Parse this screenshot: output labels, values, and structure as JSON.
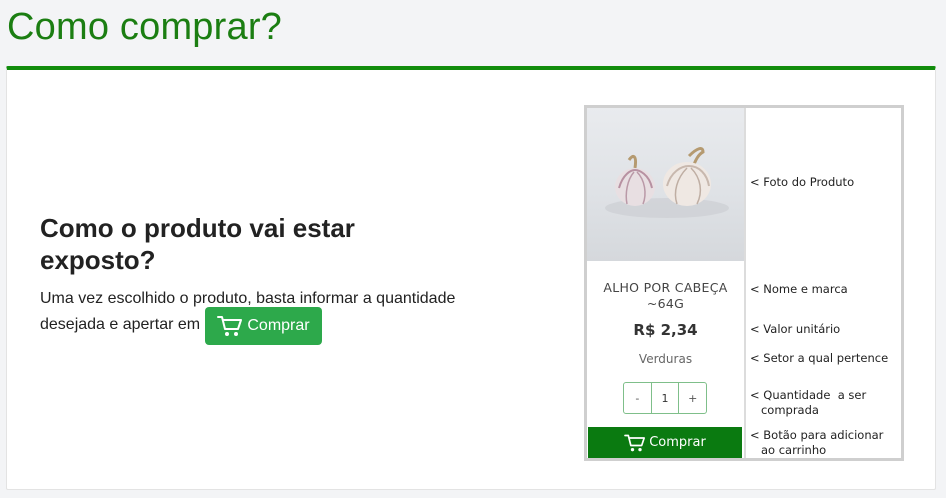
{
  "page": {
    "title": "Como comprar?"
  },
  "section": {
    "heading": "Como o produto vai estar exposto?",
    "description": "Uma vez escolhido o produto, basta informar a quantidade desejada e apertar em",
    "buy_button_label": "Comprar",
    "buy_button_icon": "cart-icon"
  },
  "example_card": {
    "product_name": "ALHO POR CABEÇA ~64G",
    "price": "R$ 2,34",
    "sector": "Verduras",
    "quantity": {
      "minus": "-",
      "value": "1",
      "plus": "+"
    },
    "buy_label": "Comprar",
    "buy_icon": "cart-icon",
    "annotations": {
      "photo": "< Foto do Produto",
      "name": "< Nome e marca",
      "unit_price": "< Valor unitário",
      "sector": "< Setor a qual pertence",
      "quantity": "< Quantidade  a ser\n   comprada",
      "button": "< Botão para adicionar\n   ao carrinho"
    }
  },
  "colors": {
    "title_green": "#1b7e12",
    "card_top_border": "#118c0c",
    "button_green": "#2da94b",
    "mock_button_green": "#0a7a10"
  }
}
